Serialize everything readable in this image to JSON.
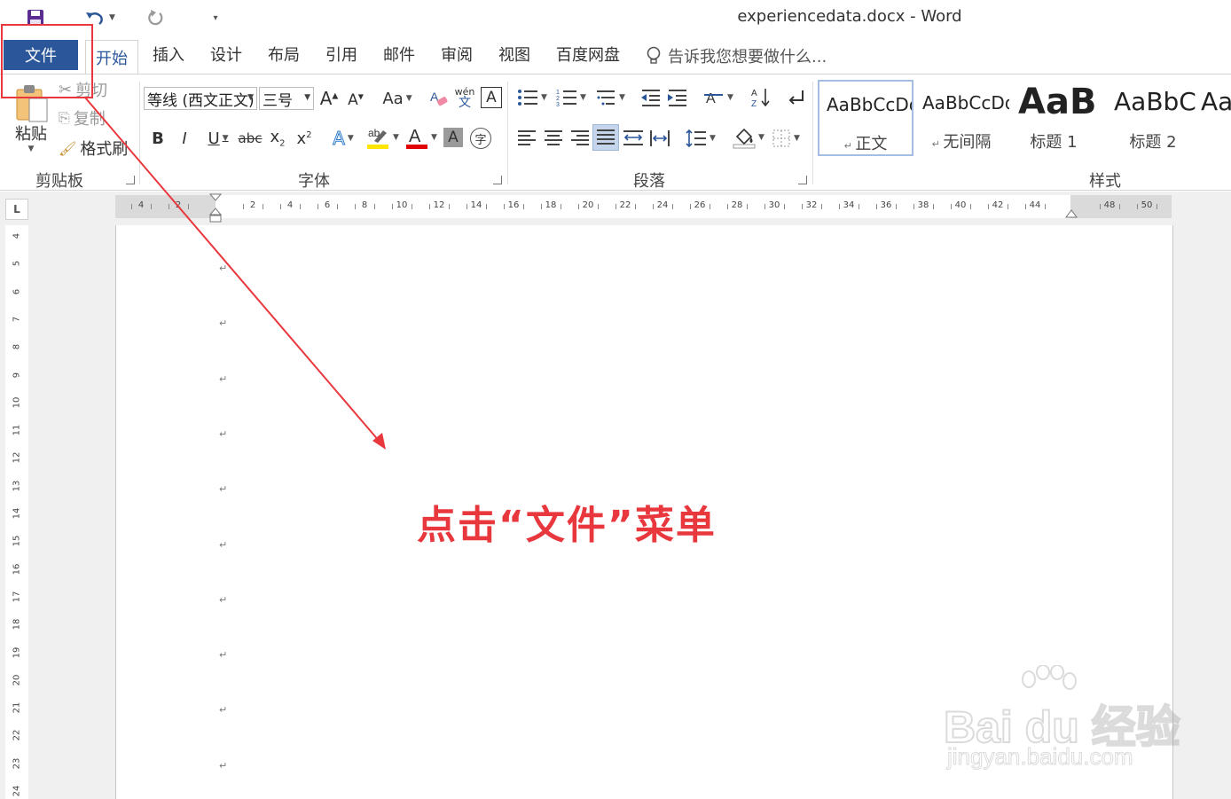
{
  "window": {
    "title": "experiencedata.docx - Word"
  },
  "tabs": [
    "文件",
    "开始",
    "插入",
    "设计",
    "布局",
    "引用",
    "邮件",
    "审阅",
    "视图",
    "百度网盘"
  ],
  "tell_me": "告诉我您想要做什么...",
  "clipboard": {
    "paste": "粘贴",
    "cut": "剪切",
    "copy": "复制",
    "format_painter": "格式刷",
    "label": "剪贴板"
  },
  "font": {
    "name": "等线 (西文正文)",
    "size": "三号",
    "label": "字体",
    "pinyin_top": "wén",
    "pinyin_bottom": "文"
  },
  "paragraph": {
    "label": "段落"
  },
  "styles": {
    "label": "样式",
    "items": [
      {
        "sample": "AaBbCcDd",
        "name": "正文"
      },
      {
        "sample": "AaBbCcDd",
        "name": "无间隔"
      },
      {
        "sample": "AaBl",
        "name": "标题 1"
      },
      {
        "sample": "AaBbC",
        "name": "标题 2"
      },
      {
        "sample": "Aa",
        "name": ""
      }
    ]
  },
  "hruler_numbers": [
    "4",
    "2",
    "2",
    "4",
    "6",
    "8",
    "10",
    "12",
    "14",
    "16",
    "18",
    "20",
    "22",
    "24",
    "26",
    "28",
    "30",
    "32",
    "34",
    "36",
    "38",
    "40",
    "42",
    "44",
    "48",
    "50"
  ],
  "vruler_numbers": [
    "4",
    "5",
    "6",
    "7",
    "8",
    "9",
    "10",
    "11",
    "12",
    "13",
    "14",
    "15",
    "16",
    "17",
    "18",
    "19",
    "20",
    "21",
    "22",
    "23",
    "24"
  ],
  "paragraph_marks": [
    "↵",
    "↵",
    "↵",
    "↵",
    "↵",
    "↵",
    "↵",
    "↵",
    "↵",
    "↵"
  ],
  "annotation": {
    "text": "点击“文件”菜单",
    "color": "#e8383d"
  },
  "watermark": {
    "main": "Bai du 经验",
    "sub": "jingyan.baidu.com"
  },
  "colors": {
    "file_tab": "#2b579a",
    "accent": "#2b579a",
    "annotation": "#e8383d"
  }
}
